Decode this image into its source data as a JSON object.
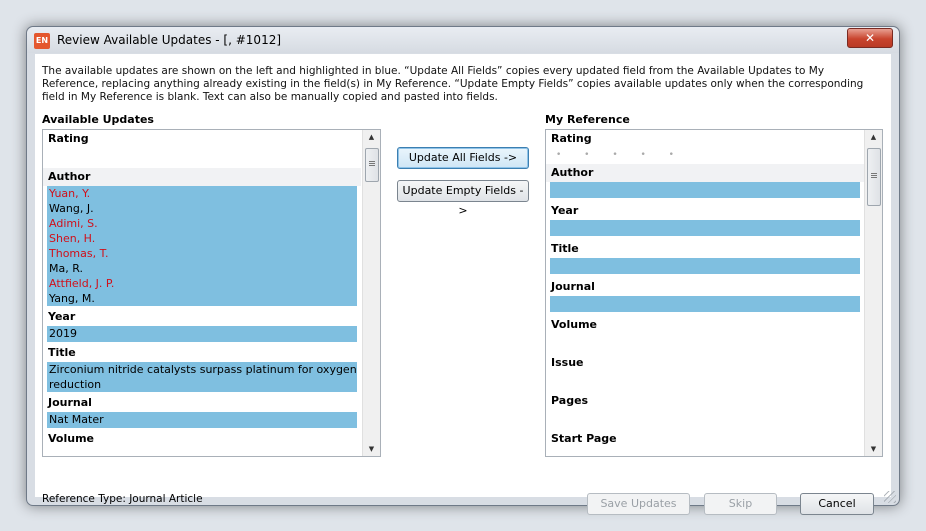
{
  "window": {
    "title": "Review Available Updates - [,  #1012]",
    "app_icon": "EN",
    "close_glyph": "✕"
  },
  "description": "The available updates are shown on the left and highlighted in blue. “Update All Fields” copies every updated field from the Available Updates to My Reference, replacing anything already existing in the field(s) in My Reference. “Update Empty Fields” copies available updates only when the corresponding field in My Reference is blank. Text can also be manually copied and pasted into fields.",
  "available": {
    "label": "Available Updates",
    "rating_label": "Rating",
    "author_label": "Author",
    "authors": [
      {
        "name": "Yuan, Y.",
        "changed": true
      },
      {
        "name": "Wang, J.",
        "changed": false
      },
      {
        "name": "Adimi, S.",
        "changed": true
      },
      {
        "name": "Shen, H.",
        "changed": true
      },
      {
        "name": "Thomas, T.",
        "changed": true
      },
      {
        "name": "Ma, R.",
        "changed": false
      },
      {
        "name": "Attfield, J. P.",
        "changed": true
      },
      {
        "name": "Yang, M.",
        "changed": false
      }
    ],
    "year_label": "Year",
    "year_value": "2019",
    "title_label": "Title",
    "title_value": "Zirconium nitride catalysts surpass platinum for oxygen reduction",
    "journal_label": "Journal",
    "journal_value": "Nat Mater",
    "volume_label": "Volume"
  },
  "reference": {
    "label": "My Reference",
    "rating_label": "Rating",
    "rating_dots": "• • • • •",
    "author_label": "Author",
    "year_label": "Year",
    "title_label": "Title",
    "journal_label": "Journal",
    "volume_label": "Volume",
    "issue_label": "Issue",
    "pages_label": "Pages",
    "start_page_label": "Start Page"
  },
  "buttons": {
    "update_all": "Update All Fields ->",
    "update_empty": "Update Empty Fields ->",
    "save": "Save Updates",
    "skip": "Skip",
    "cancel": "Cancel"
  },
  "reference_type": "Reference Type: Journal Article",
  "colors": {
    "highlight": "#7fbfe0",
    "changed_text": "#d0101a"
  },
  "icons": {
    "scroll_up": "▲",
    "scroll_down": "▼"
  }
}
